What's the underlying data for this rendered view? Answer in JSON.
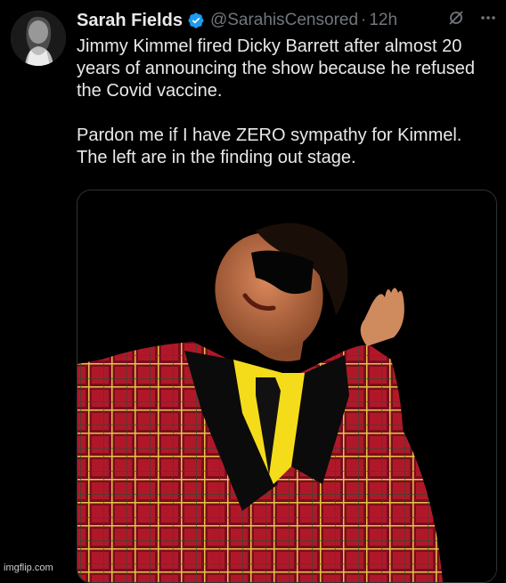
{
  "tweet": {
    "display_name": "Sarah Fields",
    "verified": true,
    "handle": "@SarahisCensored",
    "separator": "·",
    "timestamp": "12h",
    "text_paragraph_1": "Jimmy Kimmel fired Dicky Barrett after almost 20 years of announcing the show because he refused the Covid vaccine.",
    "text_paragraph_2": "Pardon me if I have ZERO sympathy for Kimmel. The left are in the finding out stage.",
    "media": {
      "type": "photo"
    }
  },
  "icons": {
    "verified": "verified-badge-icon",
    "grok": "grok-icon",
    "more": "more-options-icon"
  },
  "colors": {
    "background": "#000000",
    "text": "#e7e9ea",
    "secondary_text": "#71767b",
    "verified_blue": "#1d9bf0",
    "border": "#2f3336"
  },
  "watermark": "imgflip.com"
}
